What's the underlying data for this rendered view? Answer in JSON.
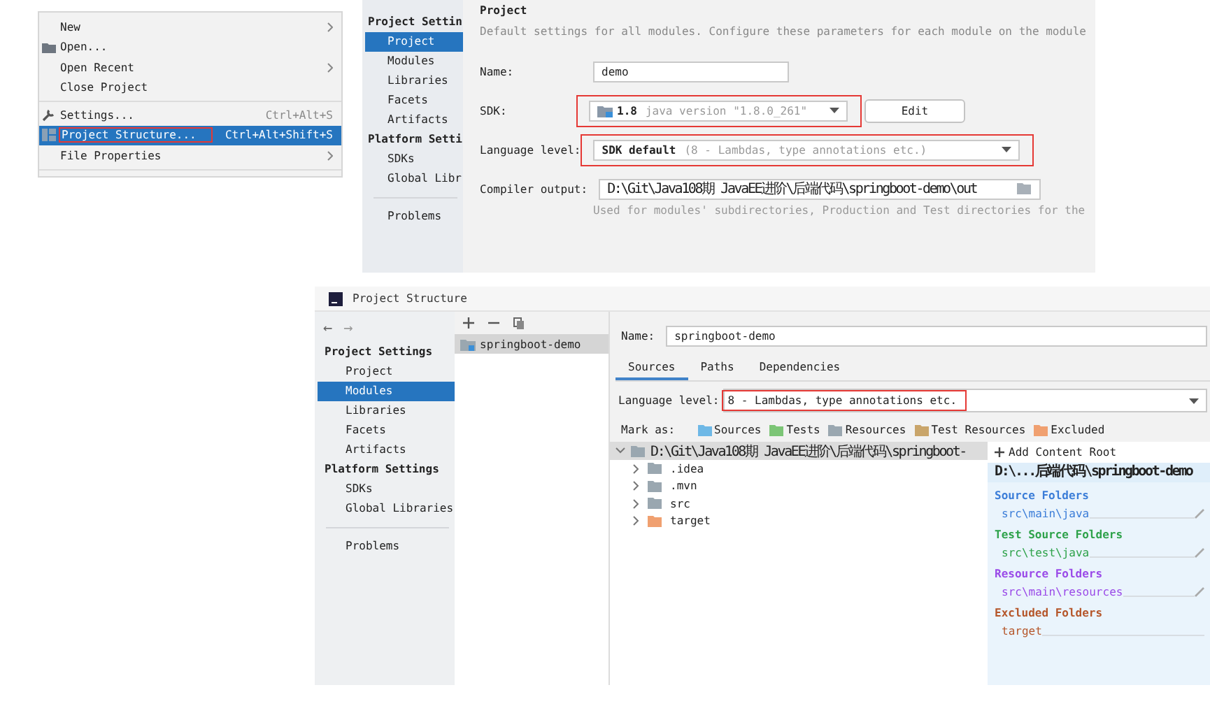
{
  "file_menu": {
    "items": [
      {
        "kind": "plain",
        "label": "New",
        "submenu": true,
        "selected": false,
        "highlighted": false
      },
      {
        "kind": "folder",
        "label": "Open...",
        "submenu": false,
        "selected": false,
        "highlighted": false
      },
      {
        "kind": "plain",
        "label": "Open Recent",
        "submenu": true,
        "selected": false,
        "highlighted": false
      },
      {
        "kind": "plain",
        "label": "Close Project",
        "submenu": false,
        "selected": false,
        "highlighted": false
      },
      {
        "kind": "separator"
      },
      {
        "kind": "wrench",
        "label": "Settings...",
        "shortcut": "Ctrl+Alt+S",
        "submenu": false,
        "selected": false,
        "highlighted": false
      },
      {
        "kind": "grid",
        "label": "Project Structure...",
        "shortcut": "Ctrl+Alt+Shift+S",
        "submenu": false,
        "selected": true,
        "highlighted": true
      },
      {
        "kind": "plain",
        "label": "File Properties",
        "submenu": true,
        "selected": false,
        "highlighted": false
      },
      {
        "kind": "separator"
      }
    ]
  },
  "project_page": {
    "sidebar": [
      {
        "title": "Project Settin",
        "items": [
          {
            "label": "Project",
            "selected": true
          },
          {
            "label": "Modules",
            "selected": false
          },
          {
            "label": "Libraries",
            "selected": false
          },
          {
            "label": "Facets",
            "selected": false
          },
          {
            "label": "Artifacts",
            "selected": false
          }
        ]
      },
      {
        "title": "Platform Setti",
        "items": [
          {
            "label": "SDKs",
            "selected": false
          },
          {
            "label": "Global Libr",
            "selected": false
          }
        ]
      }
    ],
    "sidebar_extra": [
      {
        "label": "Problems",
        "selected": false
      }
    ],
    "heading": "Project",
    "description": "Default settings for all modules. Configure these parameters for each module on the module",
    "fields": [
      {
        "kind": "text",
        "label": "Name:",
        "value": "demo"
      },
      {
        "kind": "sdk",
        "label": "SDK:",
        "value": "1.8",
        "detail": "java version \"1.8.0_261\"",
        "button": "Edit",
        "highlighted": true
      },
      {
        "kind": "select",
        "label": "Language level:",
        "value": "SDK default",
        "detail": "(8 - Lambdas, type annotations etc.)",
        "highlighted": true
      },
      {
        "kind": "path",
        "label": "Compiler output:",
        "value": "D:\\Git\\Java108期 JavaEE进阶\\后端代码\\springboot-demo\\out",
        "hint": "Used for modules' subdirectories, Production and Test directories for the"
      }
    ]
  },
  "structure_window": {
    "title": "Project Structure",
    "nav": [
      {
        "label": "←",
        "disabled": false
      },
      {
        "label": "→",
        "disabled": true
      }
    ],
    "sidebar": [
      {
        "title": "Project Settings",
        "items": [
          {
            "label": "Project",
            "selected": false
          },
          {
            "label": "Modules",
            "selected": true
          },
          {
            "label": "Libraries",
            "selected": false
          },
          {
            "label": "Facets",
            "selected": false
          },
          {
            "label": "Artifacts",
            "selected": false
          }
        ]
      },
      {
        "title": "Platform Settings",
        "items": [
          {
            "label": "SDKs",
            "selected": false
          },
          {
            "label": "Global Libraries",
            "selected": false
          }
        ]
      }
    ],
    "sidebar_extra": [
      {
        "label": "Problems",
        "selected": false
      }
    ],
    "modules": [
      {
        "label": "springboot-demo",
        "selected": true
      }
    ],
    "name_label": "Name:",
    "name_value": "springboot-demo",
    "tabs": [
      {
        "label": "Sources",
        "selected": true
      },
      {
        "label": "Paths",
        "selected": false
      },
      {
        "label": "Dependencies",
        "selected": false
      }
    ],
    "language_label": "Language level:",
    "language_value": "8 - Lambdas, type annotations etc.",
    "language_highlighted": true,
    "mark_as_label": "Mark as:",
    "mark_as": [
      {
        "label": "Sources",
        "color": "#6eb8e6"
      },
      {
        "label": "Tests",
        "color": "#7cc576"
      },
      {
        "label": "Resources",
        "color": "#9aa7b0"
      },
      {
        "label": "Test Resources",
        "color": "#c9a56a"
      },
      {
        "label": "Excluded",
        "color": "#f0a070"
      }
    ],
    "tree": {
      "label": "D:\\Git\\Java108期 JavaEE进阶\\后端代码\\springboot-",
      "expanded": true,
      "selected": true,
      "color": "#9aa7b0",
      "children": [
        {
          "label": ".idea",
          "expanded": false,
          "selected": false,
          "color": "#9aa7b0"
        },
        {
          "label": ".mvn",
          "expanded": false,
          "selected": false,
          "color": "#9aa7b0"
        },
        {
          "label": "src",
          "expanded": false,
          "selected": false,
          "color": "#9aa7b0"
        },
        {
          "label": "target",
          "expanded": false,
          "selected": false,
          "color": "#f0a070"
        }
      ]
    },
    "add_root": "Add Content Root",
    "root_path": "D:\\...后端代码\\springboot-demo",
    "folder_groups": [
      {
        "title": "Source Folders",
        "color": "#3b7dd8",
        "paths": [
          "src\\main\\java"
        ]
      },
      {
        "title": "Test Source Folders",
        "color": "#2ea24a",
        "paths": [
          "src\\test\\java"
        ]
      },
      {
        "title": "Resource Folders",
        "color": "#9a4ae8",
        "paths": [
          "src\\main\\resources"
        ]
      },
      {
        "title": "Excluded Folders",
        "color": "#b5562a",
        "paths": [
          "target"
        ]
      }
    ]
  }
}
